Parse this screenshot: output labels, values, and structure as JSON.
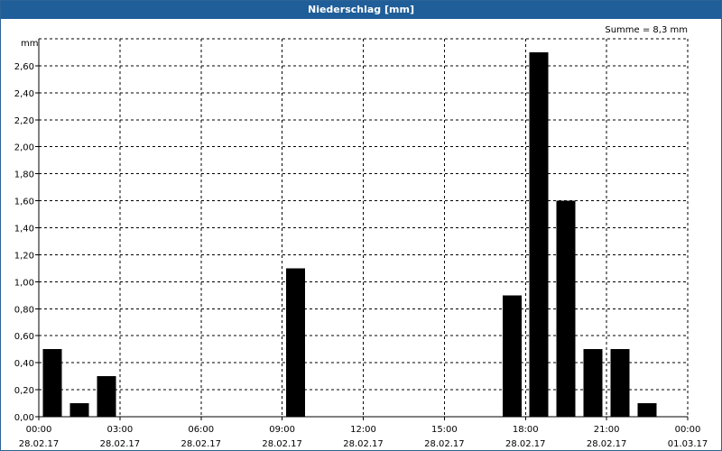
{
  "title": "Niederschlag [mm]",
  "chart_data": {
    "type": "bar",
    "title": "Niederschlag [mm]",
    "ylabel": "mm",
    "summary": "Summe = 8,3 mm",
    "ylim": [
      0,
      2.8
    ],
    "yticks": [
      "0,00",
      "0,20",
      "0,40",
      "0,60",
      "0,80",
      "1,00",
      "1,20",
      "1,40",
      "1,60",
      "1,80",
      "2,00",
      "2,20",
      "2,40",
      "2,60"
    ],
    "xlim_hours": [
      0,
      24
    ],
    "xticks": [
      {
        "time": "00:00",
        "date": "28.02.17"
      },
      {
        "time": "03:00",
        "date": "28.02.17"
      },
      {
        "time": "06:00",
        "date": "28.02.17"
      },
      {
        "time": "09:00",
        "date": "28.02.17"
      },
      {
        "time": "12:00",
        "date": "28.02.17"
      },
      {
        "time": "15:00",
        "date": "28.02.17"
      },
      {
        "time": "18:00",
        "date": "28.02.17"
      },
      {
        "time": "21:00",
        "date": "28.02.17"
      },
      {
        "time": "00:00",
        "date": "01.03.17"
      }
    ],
    "grid": true,
    "bar_color": "#000000",
    "bars": [
      {
        "hour": 0,
        "value": 0.5
      },
      {
        "hour": 1,
        "value": 0.1
      },
      {
        "hour": 2,
        "value": 0.3
      },
      {
        "hour": 9,
        "value": 1.1
      },
      {
        "hour": 17,
        "value": 0.9
      },
      {
        "hour": 18,
        "value": 2.7
      },
      {
        "hour": 19,
        "value": 1.6
      },
      {
        "hour": 20,
        "value": 0.5
      },
      {
        "hour": 21,
        "value": 0.5
      },
      {
        "hour": 22,
        "value": 0.1
      }
    ]
  }
}
